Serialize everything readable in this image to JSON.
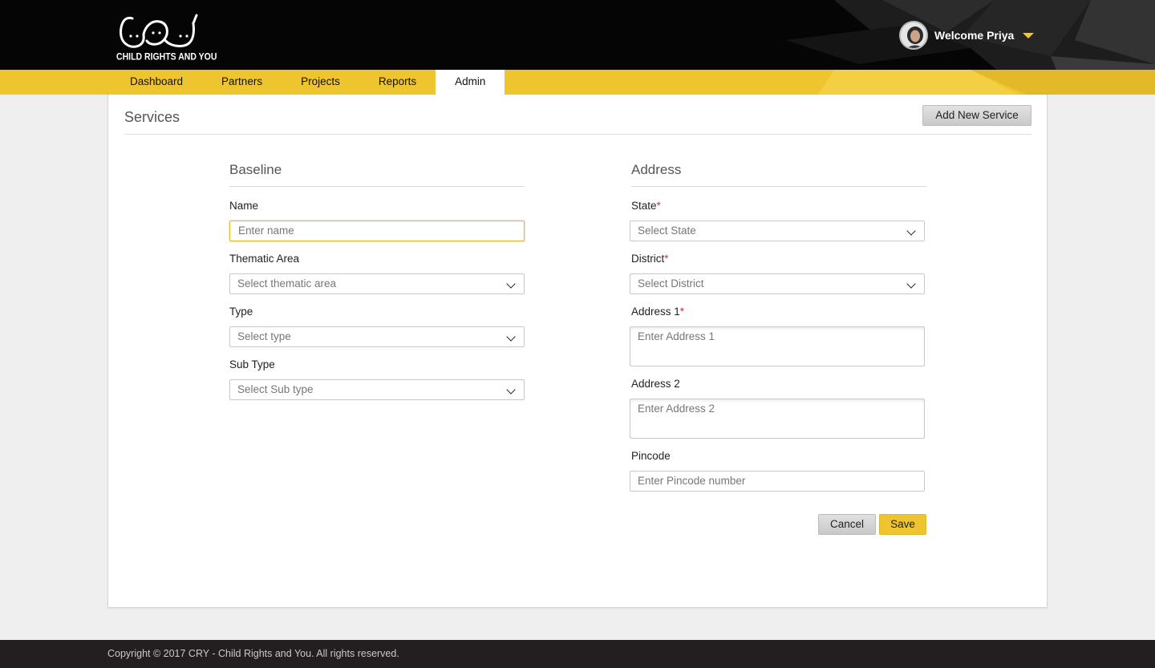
{
  "brand": {
    "logo_text": "CHILD RIGHTS AND YOU",
    "accent_color": "#efc52f"
  },
  "user": {
    "welcome": "Welcome Priya",
    "menu_icon": "caret-down-icon"
  },
  "nav": [
    {
      "label": "Dashboard",
      "active": false
    },
    {
      "label": "Partners",
      "active": false
    },
    {
      "label": "Projects",
      "active": false
    },
    {
      "label": "Reports",
      "active": false
    },
    {
      "label": "Admin",
      "active": true
    }
  ],
  "page": {
    "title": "Services",
    "add_button": "Add New Service"
  },
  "baseline": {
    "title": "Baseline",
    "name": {
      "label": "Name",
      "placeholder": "Enter name"
    },
    "thematic_area": {
      "label": "Thematic Area",
      "placeholder": "Select thematic area"
    },
    "type": {
      "label": "Type",
      "placeholder": "Select type"
    },
    "sub_type": {
      "label": "Sub Type",
      "placeholder": "Select Sub type"
    }
  },
  "address": {
    "title": "Address",
    "required_mark": "*",
    "state": {
      "label": "State",
      "placeholder": "Select State"
    },
    "district": {
      "label": "District",
      "placeholder": "Select District"
    },
    "address1": {
      "label": "Address 1",
      "placeholder": "Enter Address 1"
    },
    "address2": {
      "label": "Address 2",
      "placeholder": "Enter Address 2"
    },
    "pincode": {
      "label": "Pincode",
      "placeholder": "Enter Pincode number"
    }
  },
  "actions": {
    "cancel": "Cancel",
    "save": "Save"
  },
  "footer": {
    "copyright": "Copyright © 2017 CRY - Child Rights and You. All rights reserved."
  }
}
